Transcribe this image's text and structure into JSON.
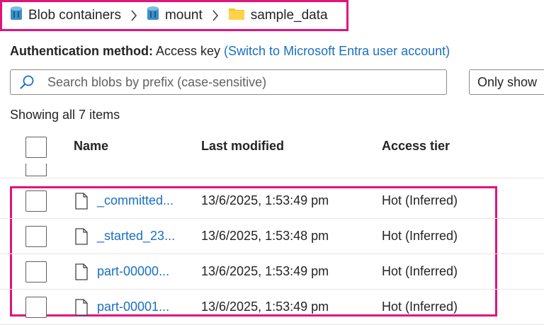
{
  "breadcrumb": {
    "items": [
      {
        "label": "Blob containers",
        "icon": "storage-container-icon"
      },
      {
        "label": "mount",
        "icon": "storage-container-icon"
      },
      {
        "label": "sample_data",
        "icon": "folder-icon"
      }
    ]
  },
  "auth": {
    "label": "Authentication method:",
    "value": "Access key",
    "switch_link": "(Switch to Microsoft Entra user account)"
  },
  "search": {
    "placeholder": "Search blobs by prefix (case-sensitive)",
    "value": ""
  },
  "filter_button": "Only show",
  "item_count": "Showing all 7 items",
  "table": {
    "columns": [
      "Name",
      "Last modified",
      "Access tier"
    ],
    "rows": [
      {
        "name": "_committed...",
        "modified": "13/6/2025, 1:53:49 pm",
        "tier": "Hot (Inferred)"
      },
      {
        "name": "_started_23...",
        "modified": "13/6/2025, 1:53:48 pm",
        "tier": "Hot (Inferred)"
      },
      {
        "name": "part-00000...",
        "modified": "13/6/2025, 1:53:49 pm",
        "tier": "Hot (Inferred)"
      },
      {
        "name": "part-00001...",
        "modified": "13/6/2025, 1:53:49 pm",
        "tier": "Hot (Inferred)"
      }
    ]
  },
  "colors": {
    "link": "#1a6fc4",
    "highlight": "#e0147a",
    "folder": "#f4c430",
    "container": "#3c8fc7"
  }
}
